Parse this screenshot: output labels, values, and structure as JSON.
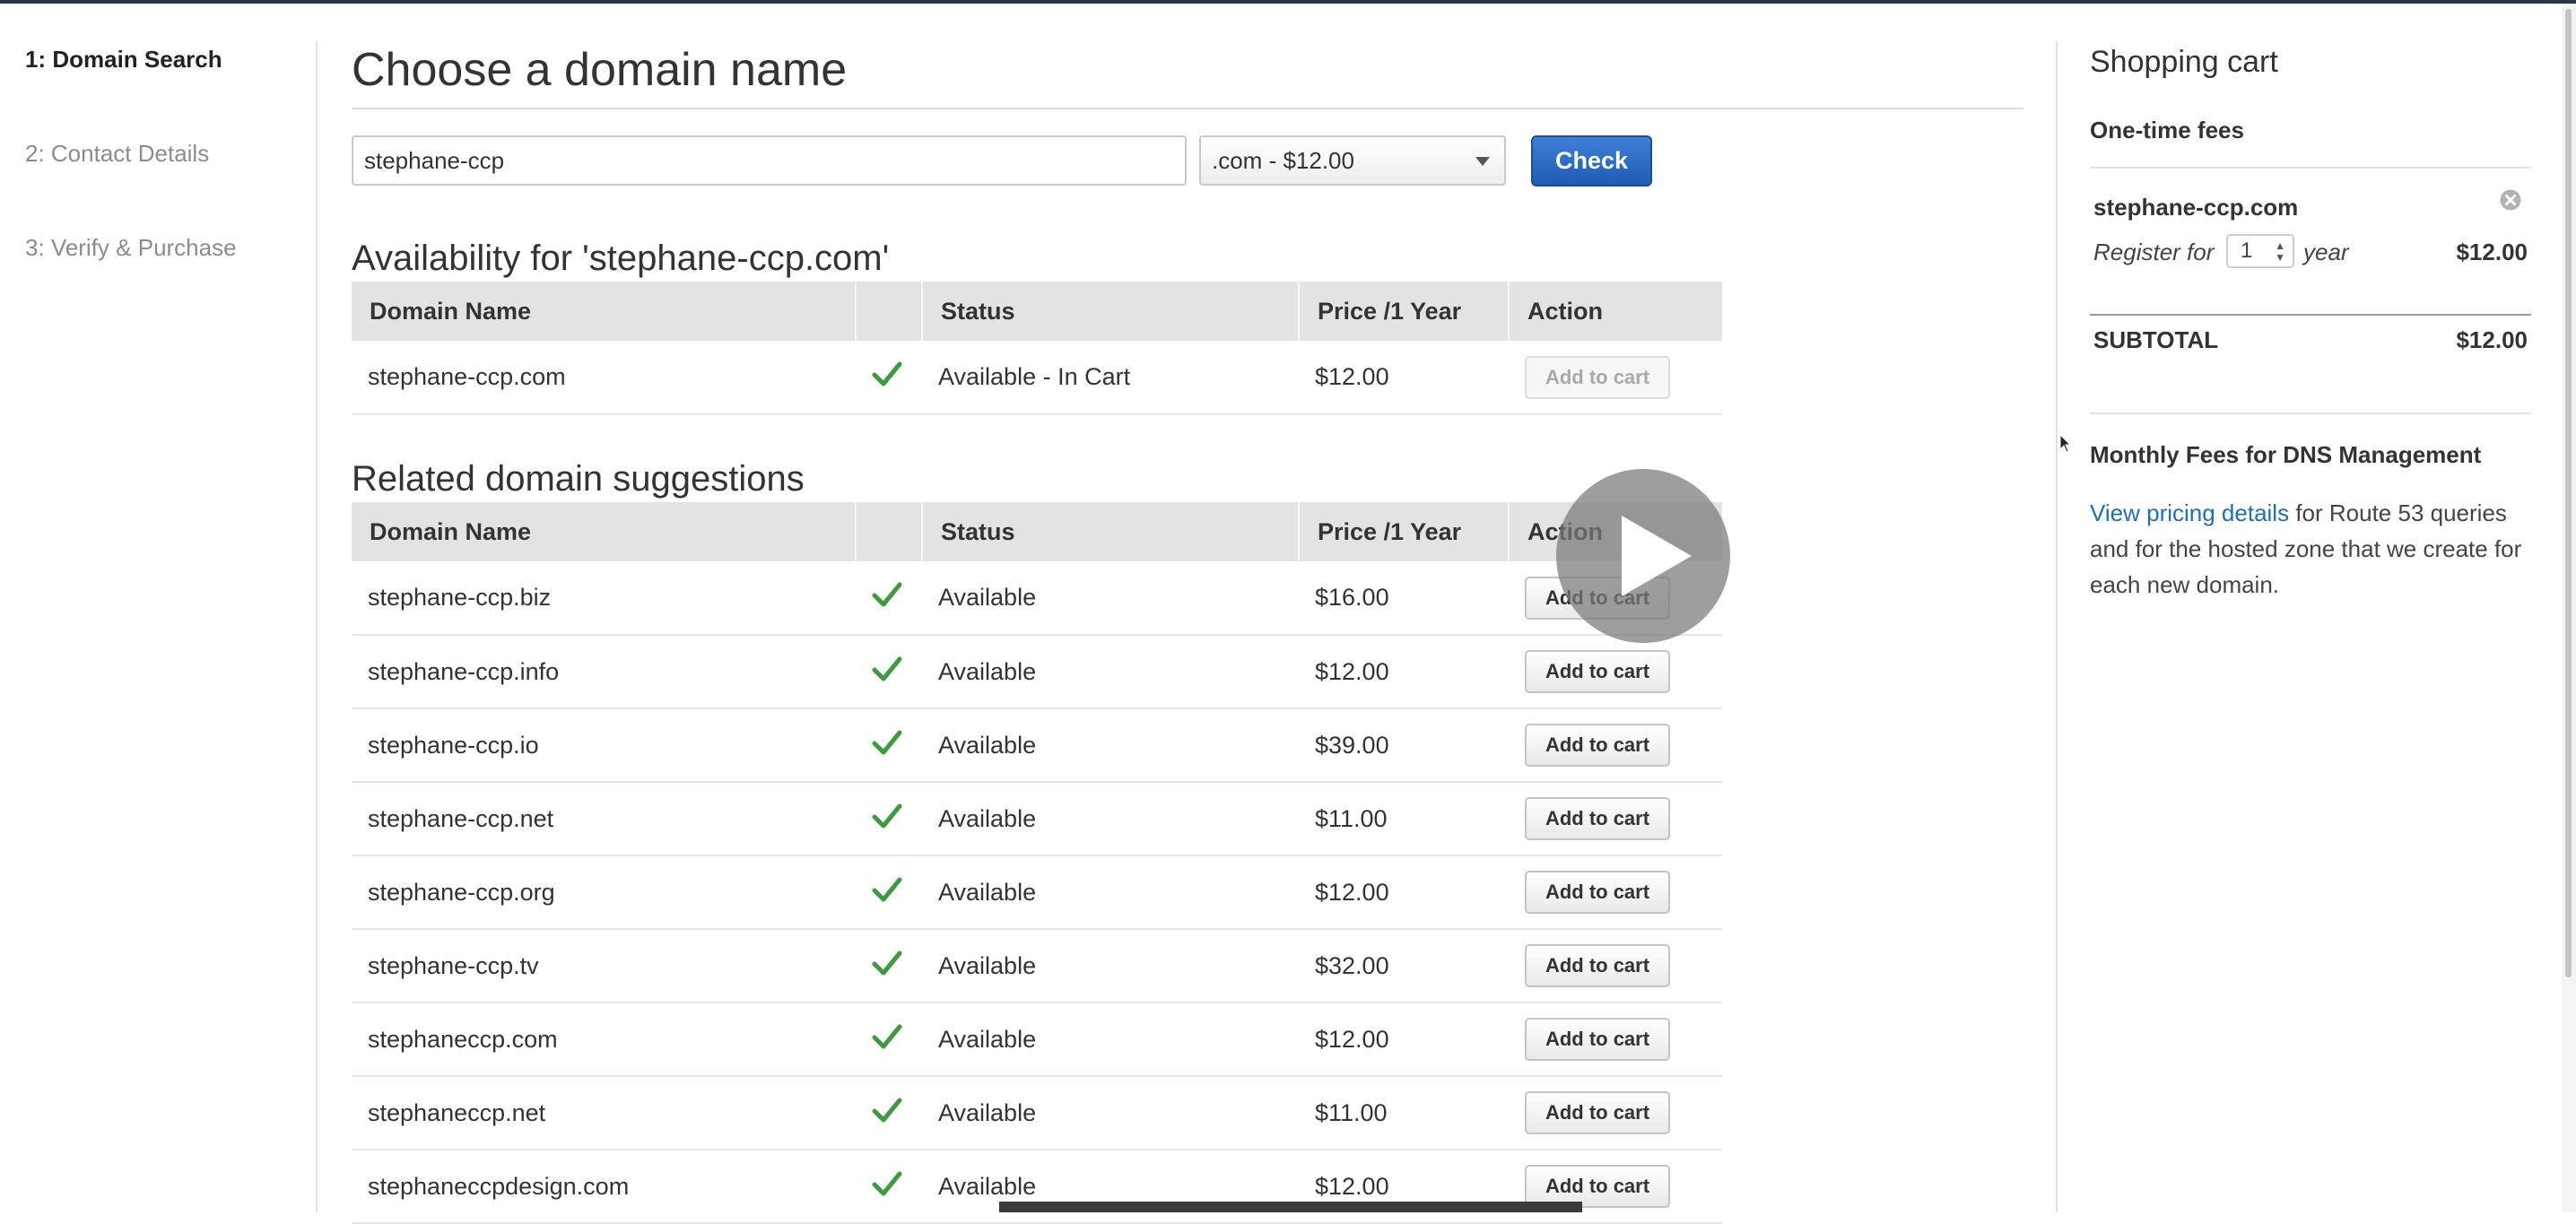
{
  "steps": [
    {
      "label": "1: Domain Search",
      "active": true
    },
    {
      "label": "2: Contact Details",
      "active": false
    },
    {
      "label": "3: Verify & Purchase",
      "active": false
    }
  ],
  "main": {
    "title": "Choose a domain name",
    "search": {
      "value": "stephane-ccp"
    },
    "tld_select": {
      "selected": ".com - $12.00"
    },
    "check_label": "Check",
    "availability": {
      "heading": "Availability for 'stephane-ccp.com'",
      "columns": [
        "Domain Name",
        "",
        "Status",
        "Price /1 Year",
        "Action"
      ],
      "rows": [
        {
          "name": "stephane-ccp.com",
          "status": "Available - In Cart",
          "price": "$12.00",
          "action": "Add to cart",
          "action_enabled": false
        }
      ]
    },
    "related": {
      "heading": "Related domain suggestions",
      "columns": [
        "Domain Name",
        "",
        "Status",
        "Price /1 Year",
        "Action"
      ],
      "rows": [
        {
          "name": "stephane-ccp.biz",
          "status": "Available",
          "price": "$16.00",
          "action": "Add to cart"
        },
        {
          "name": "stephane-ccp.info",
          "status": "Available",
          "price": "$12.00",
          "action": "Add to cart"
        },
        {
          "name": "stephane-ccp.io",
          "status": "Available",
          "price": "$39.00",
          "action": "Add to cart"
        },
        {
          "name": "stephane-ccp.net",
          "status": "Available",
          "price": "$11.00",
          "action": "Add to cart"
        },
        {
          "name": "stephane-ccp.org",
          "status": "Available",
          "price": "$12.00",
          "action": "Add to cart"
        },
        {
          "name": "stephane-ccp.tv",
          "status": "Available",
          "price": "$32.00",
          "action": "Add to cart"
        },
        {
          "name": "stephaneccp.com",
          "status": "Available",
          "price": "$12.00",
          "action": "Add to cart"
        },
        {
          "name": "stephaneccp.net",
          "status": "Available",
          "price": "$11.00",
          "action": "Add to cart"
        },
        {
          "name": "stephaneccpdesign.com",
          "status": "Available",
          "price": "$12.00",
          "action": "Add to cart"
        }
      ]
    }
  },
  "cart": {
    "title": "Shopping cart",
    "one_time_label": "One-time fees",
    "item": {
      "name": "stephane-ccp.com",
      "register_label": "Register for",
      "years": "1",
      "year_label": "year",
      "price": "$12.00"
    },
    "subtotal_label": "SUBTOTAL",
    "subtotal_value": "$12.00",
    "monthly_heading": "Monthly Fees for DNS Management",
    "pricing_link": "View pricing details",
    "monthly_text": " for Route 53 queries and for the hosted zone that we create for each new domain."
  },
  "icons": {
    "check": "checkmark-icon",
    "remove": "remove-circle-icon",
    "play": "play-icon",
    "cursor": "mouse-cursor-icon"
  },
  "colors": {
    "check_green": "#3e9a3e",
    "primary_button": "#2a6bc6",
    "link": "#1f6fb5"
  }
}
